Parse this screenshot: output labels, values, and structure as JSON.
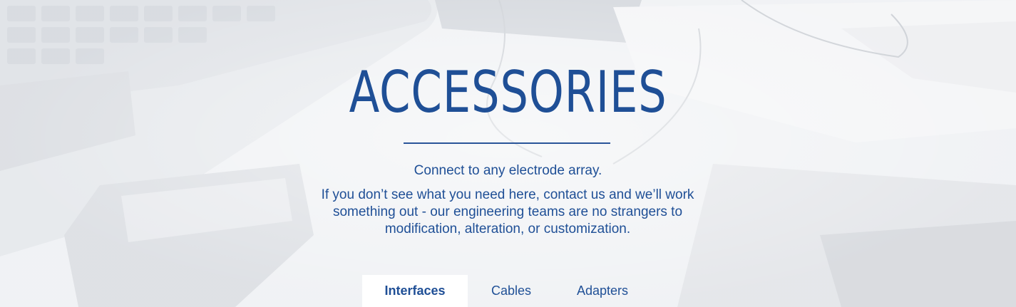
{
  "hero": {
    "title": "ACCESSORIES",
    "lead": "Connect to any electrode array.",
    "body": "If you don’t see what you need here, contact us and we’ll work something out - our engineering teams are no strangers to modification, alteration, or customization."
  },
  "tabs": [
    {
      "label": "Interfaces",
      "active": true
    },
    {
      "label": "Cables",
      "active": false
    },
    {
      "label": "Adapters",
      "active": false
    }
  ],
  "colors": {
    "accent": "#1f4f96",
    "background_tint": "#eef0f3",
    "active_tab_bg": "#ffffff"
  }
}
